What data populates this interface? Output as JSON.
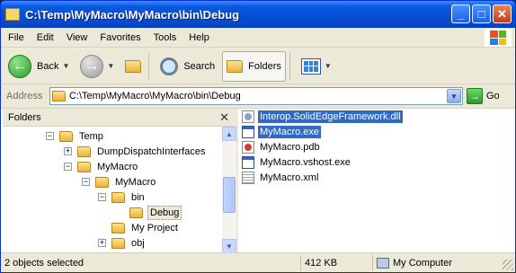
{
  "window": {
    "title": "C:\\Temp\\MyMacro\\MyMacro\\bin\\Debug"
  },
  "menu": [
    "File",
    "Edit",
    "View",
    "Favorites",
    "Tools",
    "Help"
  ],
  "toolbar": {
    "back_label": "Back",
    "search_label": "Search",
    "folders_label": "Folders"
  },
  "address": {
    "label": "Address",
    "value": "C:\\Temp\\MyMacro\\MyMacro\\bin\\Debug",
    "go_label": "Go"
  },
  "folders_pane": {
    "title": "Folders",
    "tree": [
      {
        "label": "Temp",
        "expander": "−",
        "selected": false
      },
      {
        "label": "DumpDispatchInterfaces",
        "expander": "+",
        "selected": false
      },
      {
        "label": "MyMacro",
        "expander": "−",
        "selected": false
      },
      {
        "label": "MyMacro",
        "expander": "−",
        "selected": false
      },
      {
        "label": "bin",
        "expander": "−",
        "selected": false
      },
      {
        "label": "Debug",
        "expander": "",
        "selected": true
      },
      {
        "label": "My Project",
        "expander": "",
        "selected": false
      },
      {
        "label": "obj",
        "expander": "+",
        "selected": false
      }
    ]
  },
  "files": [
    {
      "name": "Interop.SolidEdgeFramework.dll",
      "type": "dll",
      "selected": true
    },
    {
      "name": "MyMacro.exe",
      "type": "exe",
      "selected": true
    },
    {
      "name": "MyMacro.pdb",
      "type": "pdb",
      "selected": false
    },
    {
      "name": "MyMacro.vshost.exe",
      "type": "exe",
      "selected": false
    },
    {
      "name": "MyMacro.xml",
      "type": "xml",
      "selected": false
    }
  ],
  "status": {
    "selection": "2 objects selected",
    "size": "412 KB",
    "location": "My Computer"
  }
}
